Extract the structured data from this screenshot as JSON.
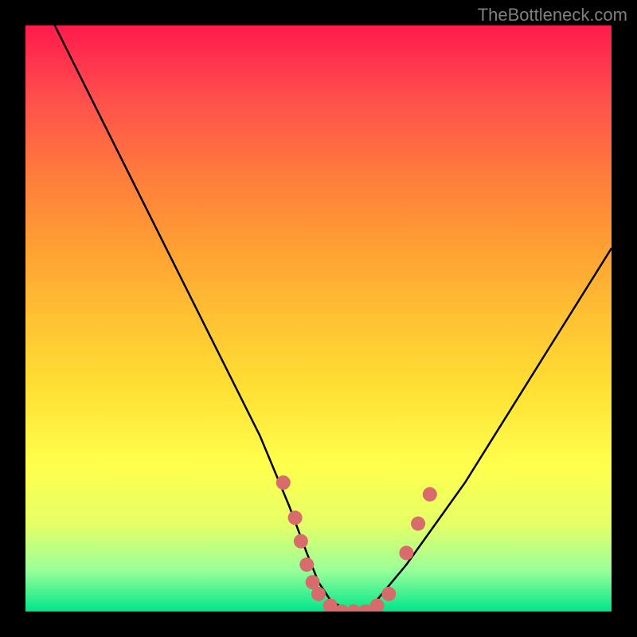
{
  "watermark": "TheBottleneck.com",
  "chart_data": {
    "type": "line",
    "title": "",
    "xlabel": "",
    "ylabel": "",
    "xlim": [
      0,
      100
    ],
    "ylim": [
      0,
      100
    ],
    "series": [
      {
        "name": "curve",
        "x": [
          5,
          10,
          15,
          20,
          25,
          30,
          35,
          40,
          45,
          48,
          50,
          52,
          55,
          58,
          60,
          65,
          70,
          75,
          80,
          85,
          90,
          95,
          100
        ],
        "y": [
          100,
          90,
          80,
          70,
          60,
          50,
          40,
          30,
          18,
          10,
          5,
          2,
          0,
          0,
          2,
          8,
          15,
          22,
          30,
          38,
          46,
          54,
          62
        ]
      }
    ],
    "markers": {
      "name": "dots",
      "color": "#d86b6b",
      "points": [
        {
          "x": 44,
          "y": 22
        },
        {
          "x": 46,
          "y": 16
        },
        {
          "x": 47,
          "y": 12
        },
        {
          "x": 48,
          "y": 8
        },
        {
          "x": 49,
          "y": 5
        },
        {
          "x": 50,
          "y": 3
        },
        {
          "x": 52,
          "y": 1
        },
        {
          "x": 54,
          "y": 0
        },
        {
          "x": 56,
          "y": 0
        },
        {
          "x": 58,
          "y": 0
        },
        {
          "x": 60,
          "y": 1
        },
        {
          "x": 62,
          "y": 3
        },
        {
          "x": 65,
          "y": 10
        },
        {
          "x": 67,
          "y": 15
        },
        {
          "x": 69,
          "y": 20
        }
      ]
    },
    "gradient_stops": [
      {
        "pos": 0,
        "color": "#ff1a4d"
      },
      {
        "pos": 50,
        "color": "#ffc233"
      },
      {
        "pos": 80,
        "color": "#ffff4d"
      },
      {
        "pos": 100,
        "color": "#00e68a"
      }
    ]
  }
}
